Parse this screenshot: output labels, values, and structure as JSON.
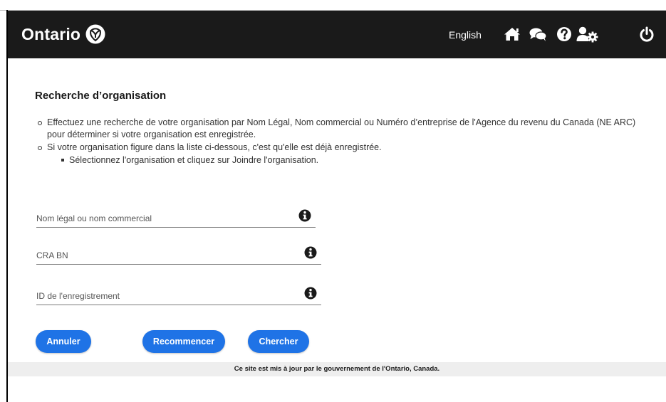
{
  "header": {
    "logo_text": "Ontario",
    "language_link": "English",
    "icons": [
      "home-icon",
      "chat-icon",
      "help-icon",
      "user-settings-icon",
      "power-icon"
    ],
    "background": "#1a1a1a"
  },
  "page": {
    "title": "Recherche d’organisation",
    "instructions": [
      "Effectuez une recherche de votre organisation par Nom Légal, Nom commercial ou Numéro d’entreprise de l'Agence du revenu du Canada (NE ARC) pour déterminer si votre organisation est enregistrée.",
      "Si votre organisation figure dans la liste ci-dessous, c'est qu'elle est déjà enregistrée."
    ],
    "sub_instruction": "Sélectionnez l'organisation et cliquez sur Joindre l'organisation."
  },
  "form": {
    "legal_name_placeholder": "Nom légal ou nom commercial",
    "legal_name_value": "",
    "cra_bn_placeholder": "CRA BN",
    "cra_bn_value": "",
    "registration_id_placeholder": "ID de l'enregistrement",
    "registration_id_value": ""
  },
  "buttons": {
    "cancel": "Annuler",
    "reset": "Recommencer",
    "search": "Chercher",
    "color": "#1f73e6"
  },
  "footer": {
    "text": "Ce site est mis à jour par le gouvernement de l'Ontario, Canada."
  }
}
